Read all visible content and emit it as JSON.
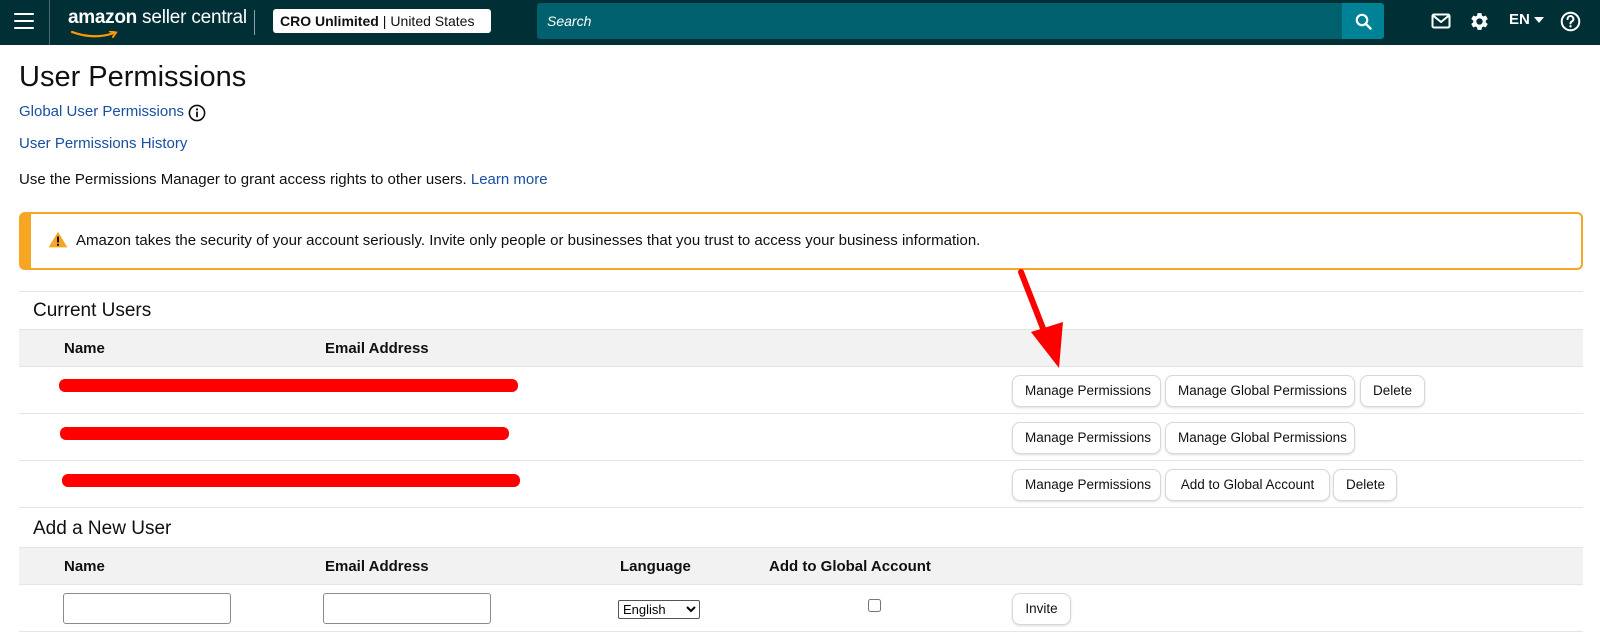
{
  "header": {
    "logo_brand": "amazon",
    "logo_rest": " seller central",
    "account_name": "CRO Unlimited",
    "account_separator": "|",
    "account_region": "United States",
    "search_placeholder": "Search",
    "language": "EN",
    "icons": [
      "menu-icon",
      "search-icon",
      "mail-icon",
      "gear-icon",
      "chevron-down-icon",
      "help-icon"
    ]
  },
  "page": {
    "title": "User Permissions",
    "global_link": "Global User Permissions",
    "history_link": "User Permissions History",
    "intro_text": "Use the Permissions Manager to grant access rights to other users.",
    "learn_more": "Learn more",
    "alert_text": "Amazon takes the security of your account seriously. Invite only people or businesses that you trust to access your business information."
  },
  "current_users": {
    "title": "Current Users",
    "columns": [
      "Name",
      "Email Address"
    ],
    "rows": [
      {
        "actions": [
          "Manage Permissions",
          "Manage Global Permissions",
          "Delete"
        ]
      },
      {
        "actions": [
          "Manage Permissions",
          "Manage Global Permissions"
        ]
      },
      {
        "actions": [
          "Manage Permissions",
          "Add to Global Account",
          "Delete"
        ]
      }
    ]
  },
  "new_user": {
    "title": "Add a New User",
    "columns": [
      "Name",
      "Email Address",
      "Language",
      "Add to Global Account"
    ],
    "name_value": "",
    "email_value": "",
    "language_selected": "English",
    "add_to_global_checked": false,
    "invite_label": "Invite"
  },
  "colors": {
    "header_bg": "#002f36",
    "search_bg": "#00606e",
    "search_button": "#008296",
    "link": "#1a4fa0",
    "alert_border": "#f6a623",
    "redaction": "#ff0000",
    "annotation_arrow": "#ff0000"
  }
}
